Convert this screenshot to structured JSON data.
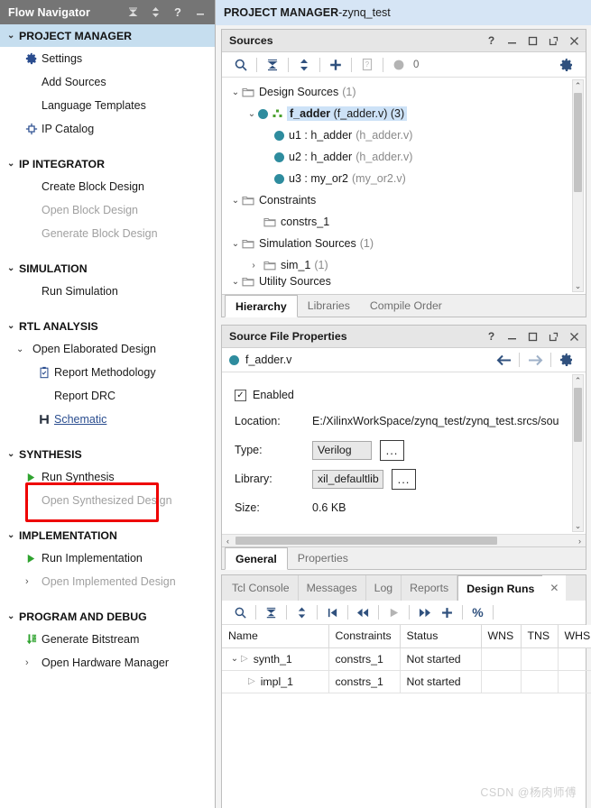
{
  "flow_navigator": {
    "title": "Flow Navigator",
    "header_icons": [
      "collapse-all-icon",
      "expand-collapse-icon",
      "help-icon",
      "minimize-icon"
    ],
    "sections": [
      {
        "label": "PROJECT MANAGER",
        "active": true,
        "items": [
          {
            "label": "Settings",
            "icon": "gear-icon",
            "disabled": false
          },
          {
            "label": "Add Sources",
            "icon": "none",
            "disabled": false
          },
          {
            "label": "Language Templates",
            "icon": "none",
            "disabled": false
          },
          {
            "label": "IP Catalog",
            "icon": "ip-catalog-icon",
            "disabled": false
          }
        ]
      },
      {
        "label": "IP INTEGRATOR",
        "active": false,
        "items": [
          {
            "label": "Create Block Design",
            "icon": "none",
            "disabled": false
          },
          {
            "label": "Open Block Design",
            "icon": "none",
            "disabled": true
          },
          {
            "label": "Generate Block Design",
            "icon": "none",
            "disabled": true
          }
        ]
      },
      {
        "label": "SIMULATION",
        "active": false,
        "items": [
          {
            "label": "Run Simulation",
            "icon": "none",
            "disabled": false
          }
        ]
      },
      {
        "label": "RTL ANALYSIS",
        "active": false,
        "items": [
          {
            "label": "Open Elaborated Design",
            "icon": "chevron-down-icon",
            "disabled": false
          },
          {
            "label": "Report Methodology",
            "icon": "report-methodology-icon",
            "disabled": false
          },
          {
            "label": "Report DRC",
            "icon": "none",
            "disabled": false
          },
          {
            "label": "Schematic",
            "icon": "schematic-icon",
            "disabled": false,
            "link": true,
            "highlighted": true
          }
        ]
      },
      {
        "label": "SYNTHESIS",
        "active": false,
        "items": [
          {
            "label": "Run Synthesis",
            "icon": "play-icon",
            "disabled": false
          },
          {
            "label": "Open Synthesized Design",
            "icon": "chevron-right-icon",
            "disabled": true
          }
        ]
      },
      {
        "label": "IMPLEMENTATION",
        "active": false,
        "items": [
          {
            "label": "Run Implementation",
            "icon": "play-icon",
            "disabled": false
          },
          {
            "label": "Open Implemented Design",
            "icon": "chevron-right-icon",
            "disabled": true
          }
        ]
      },
      {
        "label": "PROGRAM AND DEBUG",
        "active": false,
        "items": [
          {
            "label": "Generate Bitstream",
            "icon": "generate-bitstream-icon",
            "disabled": false
          },
          {
            "label": "Open Hardware Manager",
            "icon": "chevron-right-icon",
            "disabled": false
          }
        ]
      }
    ]
  },
  "project_bar": {
    "mode": "PROJECT MANAGER",
    "separator": " - ",
    "project": "zynq_test"
  },
  "sources_panel": {
    "title": "Sources",
    "title_icons": [
      "help-icon",
      "minimize-icon",
      "maximize-icon",
      "float-icon",
      "close-icon"
    ],
    "toolbar": {
      "icons": [
        "search-icon",
        "collapse-all-icon",
        "expand-all-icon",
        "add-sources-icon",
        "report-icon"
      ],
      "status_count": "0"
    },
    "gear_icon": "gear-icon",
    "tree": [
      {
        "level": 1,
        "twisty": "down",
        "icon": "folder",
        "label": "Design Sources",
        "count": "(1)"
      },
      {
        "level": 2,
        "twisty": "down",
        "icon": "dot-hier",
        "label": "f_adder",
        "file": "(f_adder.v)",
        "count": "(3)",
        "selected": true
      },
      {
        "level": 3,
        "twisty": "none",
        "icon": "dot",
        "label": "u1 : h_adder",
        "file": "(h_adder.v)",
        "count": ""
      },
      {
        "level": 3,
        "twisty": "none",
        "icon": "dot",
        "label": "u2 : h_adder",
        "file": "(h_adder.v)",
        "count": ""
      },
      {
        "level": 3,
        "twisty": "none",
        "icon": "dot",
        "label": "u3 : my_or2",
        "file": "(my_or2.v)",
        "count": ""
      },
      {
        "level": 1,
        "twisty": "down",
        "icon": "folder",
        "label": "Constraints",
        "file": "",
        "count": ""
      },
      {
        "level": 2,
        "twisty": "none",
        "icon": "folder",
        "label": "constrs_1",
        "file": "",
        "count": ""
      },
      {
        "level": 1,
        "twisty": "down",
        "icon": "folder",
        "label": "Simulation Sources",
        "file": "",
        "count": "(1)"
      },
      {
        "level": 2,
        "twisty": "right",
        "icon": "folder",
        "label": "sim_1",
        "file": "",
        "count": "(1)"
      },
      {
        "level": 1,
        "twisty": "down",
        "icon": "folder",
        "label": "Utility Sources",
        "file": "",
        "count": ""
      }
    ],
    "tabs": [
      {
        "label": "Hierarchy",
        "active": true
      },
      {
        "label": "Libraries",
        "active": false
      },
      {
        "label": "Compile Order",
        "active": false
      }
    ]
  },
  "properties_panel": {
    "title": "Source File Properties",
    "title_icons": [
      "help-icon",
      "minimize-icon",
      "maximize-icon",
      "float-icon",
      "close-icon"
    ],
    "file_name": "f_adder.v",
    "nav_icons": [
      "back-arrow-icon",
      "forward-arrow-icon",
      "gear-icon"
    ],
    "enabled_label": "Enabled",
    "enabled_checked": true,
    "fields": [
      {
        "label": "Location:",
        "value": "E:/XilinxWorkSpace/zynq_test/zynq_test.srcs/sou",
        "type": "text"
      },
      {
        "label": "Type:",
        "value": "Verilog",
        "type": "combo",
        "browse": "..."
      },
      {
        "label": "Library:",
        "value": "xil_defaultlib",
        "type": "combo",
        "browse": "..."
      },
      {
        "label": "Size:",
        "value": "0.6 KB",
        "type": "text"
      }
    ],
    "tabs": [
      {
        "label": "General",
        "active": true
      },
      {
        "label": "Properties",
        "active": false
      }
    ]
  },
  "runs_panel": {
    "tabs": [
      {
        "label": "Tcl Console",
        "active": false
      },
      {
        "label": "Messages",
        "active": false
      },
      {
        "label": "Log",
        "active": false
      },
      {
        "label": "Reports",
        "active": false
      },
      {
        "label": "Design Runs",
        "active": true
      }
    ],
    "close_icon": "close-icon",
    "toolbar_icons": [
      "search-icon",
      "collapse-all-icon",
      "expand-all-icon",
      "first-icon",
      "prev-icon",
      "run-icon",
      "next-icon",
      "add-icon",
      "percent-icon"
    ],
    "columns": [
      "Name",
      "Constraints",
      "Status",
      "WNS",
      "TNS",
      "WHS"
    ],
    "rows": [
      {
        "twisty": "down",
        "tri": "play",
        "indent": 0,
        "name": "synth_1",
        "constraints": "constrs_1",
        "status": "Not started",
        "wns": "",
        "tns": "",
        "whs": ""
      },
      {
        "twisty": "none",
        "tri": "play",
        "indent": 1,
        "name": "impl_1",
        "constraints": "constrs_1",
        "status": "Not started",
        "wns": "",
        "tns": "",
        "whs": ""
      }
    ]
  },
  "watermark": "CSDN @杨肉师傅",
  "colors": {
    "accent": "#2a4d8f",
    "highlight": "#c6deef",
    "selection": "#cde2f7",
    "teal": "#2e8c9e",
    "green": "#2fa32f",
    "red_box": "#ee0000"
  }
}
